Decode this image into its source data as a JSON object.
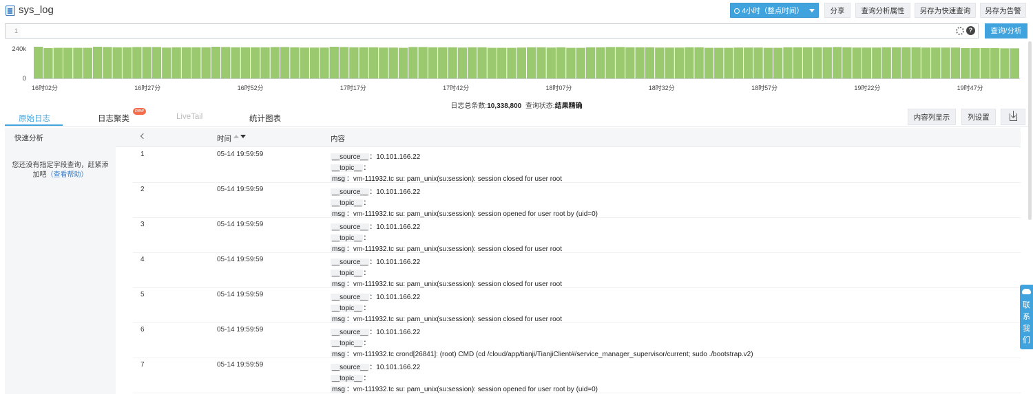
{
  "header": {
    "title": "sys_log",
    "time_range": "4小时（整点时间）",
    "buttons": {
      "share": "分享",
      "props": "查询分析属性",
      "quick": "另存为快速查询",
      "alert": "另存为告警"
    }
  },
  "query": {
    "line_number": "1",
    "value": "",
    "search_button": "查询/分析"
  },
  "chart_data": {
    "type": "bar",
    "y_ticks": [
      "240k",
      "0"
    ],
    "ylim": [
      0,
      260000
    ],
    "x_ticks": [
      "16时02分",
      "16时27分",
      "16时52分",
      "17时17分",
      "17时42分",
      "18时07分",
      "18时32分",
      "18时57分",
      "19时22分",
      "19时47分"
    ],
    "values": [
      240000,
      230000,
      232000,
      232000,
      232000,
      232000,
      240000,
      238000,
      236000,
      236000,
      238000,
      238000,
      238000,
      234000,
      236000,
      236000,
      236000,
      236000,
      240000,
      238000,
      236000,
      236000,
      236000,
      236000,
      238000,
      238000,
      236000,
      234000,
      234000,
      234000,
      240000,
      238000,
      236000,
      236000,
      236000,
      234000,
      234000,
      232000,
      238000,
      238000,
      236000,
      236000,
      236000,
      234000,
      236000,
      236000,
      232000,
      232000,
      232000,
      234000,
      236000,
      236000,
      234000,
      236000,
      232000,
      232000,
      236000,
      236000,
      238000,
      238000,
      236000,
      236000,
      236000,
      234000,
      234000,
      234000,
      236000,
      236000,
      232000,
      232000,
      232000,
      234000,
      234000,
      234000,
      232000,
      232000,
      236000,
      236000,
      236000,
      236000,
      236000,
      238000,
      236000,
      234000,
      234000,
      234000,
      236000,
      236000,
      236000,
      236000,
      234000,
      234000,
      234000,
      234000,
      230000,
      230000,
      230000,
      230000,
      228000,
      228000
    ]
  },
  "summary": {
    "total_label": "日志总条数:",
    "total_value": "10,338,800",
    "status_label": "查询状态:",
    "status_value": "结果精确"
  },
  "tabs": {
    "raw": "原始日志",
    "cluster": "日志聚类",
    "cluster_badge": "new",
    "livetail": "LiveTail",
    "stats": "统计图表"
  },
  "toolbar": {
    "content_display": "内容列显示",
    "column_settings": "列设置"
  },
  "sidebar": {
    "title": "快速分析",
    "hint": "您还没有指定字段查询，赶紧添加吧",
    "help_link": "（查看帮助）"
  },
  "table": {
    "headers": {
      "time": "时间",
      "content": "内容"
    },
    "rows": [
      {
        "no": "1",
        "time": "05-14 19:59:59",
        "source": "10.101.166.22",
        "topic": "",
        "msg": "vm-111932.tc su: pam_unix(su:session): session closed for user root"
      },
      {
        "no": "2",
        "time": "05-14 19:59:59",
        "source": "10.101.166.22",
        "topic": "",
        "msg": "vm-111932.tc su: pam_unix(su:session): session opened for user root by (uid=0)"
      },
      {
        "no": "3",
        "time": "05-14 19:59:59",
        "source": "10.101.166.22",
        "topic": "",
        "msg": "vm-111932.tc su: pam_unix(su:session): session closed for user root"
      },
      {
        "no": "4",
        "time": "05-14 19:59:59",
        "source": "10.101.166.22",
        "topic": "",
        "msg": "vm-111932.tc su: pam_unix(su:session): session closed for user root"
      },
      {
        "no": "5",
        "time": "05-14 19:59:59",
        "source": "10.101.166.22",
        "topic": "",
        "msg": "vm-111932.tc su: pam_unix(su:session): session closed for user root"
      },
      {
        "no": "6",
        "time": "05-14 19:59:59",
        "source": "10.101.166.22",
        "topic": "",
        "msg": "vm-111932.tc crond[26841]: (root) CMD (cd /cloud/app/tianji/TianjiClient#/service_manager_supervisor/current; sudo ./bootstrap.v2)"
      },
      {
        "no": "7",
        "time": "05-14 19:59:59",
        "source": "10.101.166.22",
        "topic": "",
        "msg": "vm-111932.tc su: pam_unix(su:session): session opened for user root by (uid=0)"
      }
    ],
    "field_labels": {
      "source": "__source__",
      "topic": "__topic__",
      "msg": "msg"
    },
    "separator": "："
  },
  "contact": {
    "label": "联系我们"
  },
  "colors": {
    "accent": "#41a3dd",
    "bar": "#9bc96f",
    "link": "#3d7fc7"
  }
}
